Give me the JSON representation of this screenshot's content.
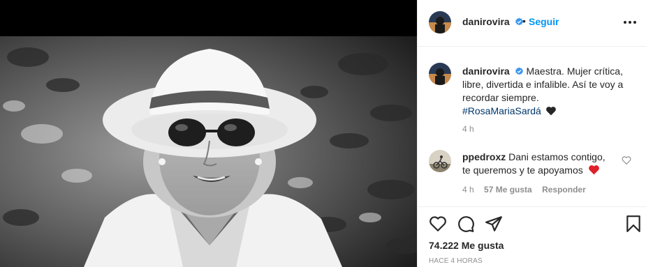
{
  "post": {
    "author": "danirovira",
    "follow_label": "Seguir",
    "separator": "•",
    "photo_subject": "Black and white portrait of a smiling woman wearing a white hat and round sunglasses"
  },
  "caption": {
    "author": "danirovira",
    "text": "Maestra. Mujer crítica, libre, divertida e infalible. Así te voy a recordar siempre.",
    "hashtag": "#RosaMariaSardá",
    "emoji": "black-heart",
    "time": "4 h"
  },
  "comment": {
    "author": "ppedroxz",
    "text": "Dani estamos contigo, te queremos y te apoyamos",
    "emoji": "red-heart",
    "time": "4 h",
    "likes": "57 Me gusta",
    "reply_label": "Responder"
  },
  "actions": {
    "likes": "74.222 Me gusta",
    "posted": "HACE 4 HORAS"
  },
  "colors": {
    "link_blue": "#0095f6",
    "hashtag": "#00376b",
    "secondary_text": "#8e8e8e",
    "heart_red": "#ed4956"
  },
  "icons": [
    "verified-badge-icon",
    "more-options-icon",
    "heart-icon",
    "comment-icon",
    "share-icon",
    "bookmark-icon",
    "like-small-icon"
  ]
}
